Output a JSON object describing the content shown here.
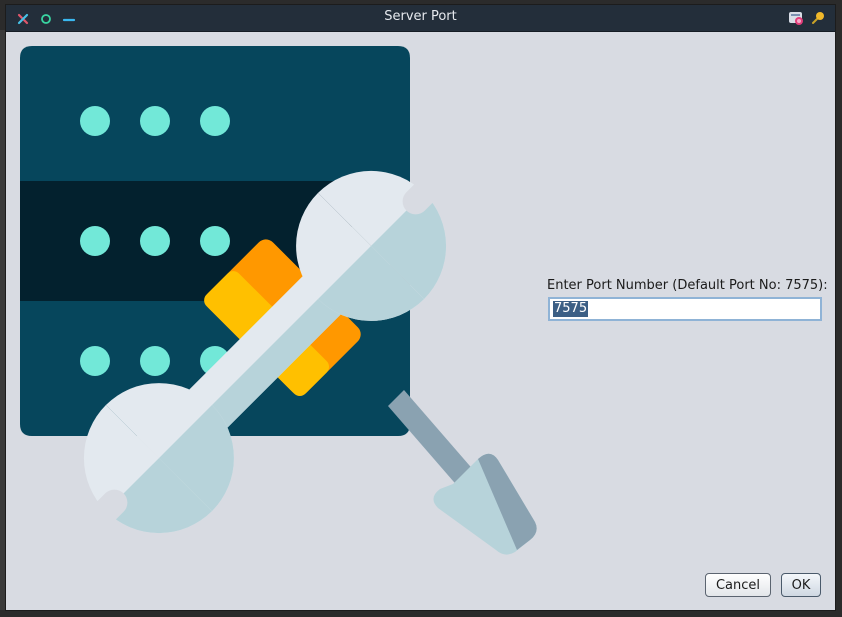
{
  "window": {
    "title": "Server Port"
  },
  "titlebar": {
    "close_icon": "close-icon",
    "maximize_icon": "maximize-icon",
    "minimize_icon": "minimize-icon",
    "app_icon": "app-icon",
    "pin_icon": "pin-icon"
  },
  "hero": {
    "icon": "server-settings-illustration",
    "colors": {
      "rack_top": "#06465c",
      "rack_middle": "#03212e",
      "rack_bottom": "#06465c",
      "led": "#72e8d8",
      "wrench_light": "#e3e9ef",
      "wrench_shadow": "#b7d3da",
      "handle_yellow": "#ffc000",
      "handle_orange": "#ff9800",
      "screwdriver_blade": "#8aa2b1"
    }
  },
  "form": {
    "label": "Enter Port Number (Default Port No: 7575):",
    "port_value": "7575"
  },
  "buttons": {
    "cancel": "Cancel",
    "ok": "OK"
  }
}
